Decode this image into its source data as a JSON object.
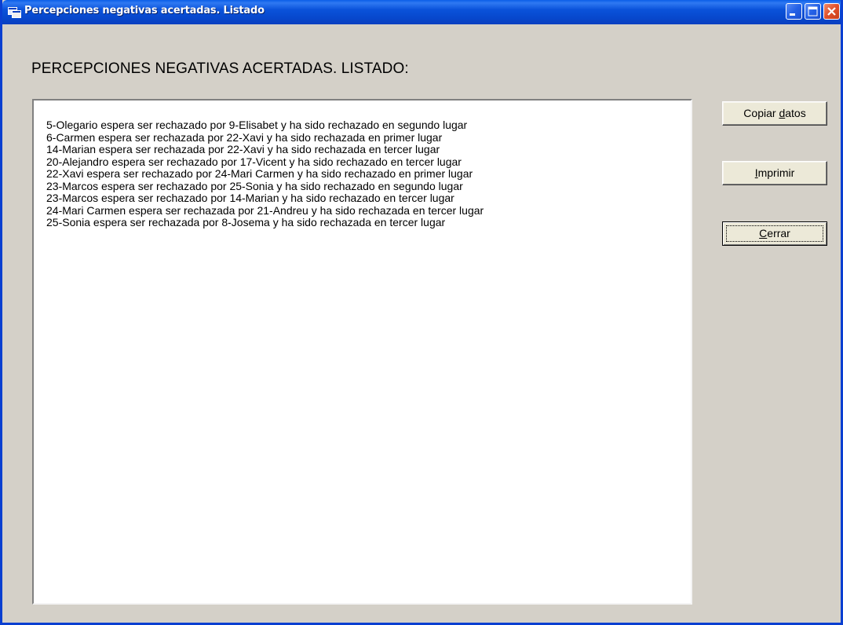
{
  "window": {
    "title": "Percepciones negativas acertadas. Listado",
    "icon": "app-window-icon"
  },
  "heading": "PERCEPCIONES NEGATIVAS ACERTADAS. LISTADO:",
  "list": {
    "items": [
      "5-Olegario espera ser rechazado por 9-Elisabet y ha sido rechazado en segundo lugar",
      "6-Carmen espera ser rechazada por 22-Xavi y ha sido rechazada en primer lugar",
      "14-Marian espera ser rechazada por 22-Xavi y ha sido rechazada en tercer lugar",
      "20-Alejandro espera ser rechazado por 17-Vicent y ha sido rechazado en tercer lugar",
      "22-Xavi espera ser rechazado por 24-Mari Carmen y ha sido rechazado en primer lugar",
      "23-Marcos espera ser rechazado por 25-Sonia y ha sido rechazado en segundo lugar",
      "23-Marcos espera ser rechazado por 14-Marian y ha sido rechazado en tercer lugar",
      "24-Mari Carmen espera ser rechazada por 21-Andreu y ha sido rechazada en tercer lugar",
      "25-Sonia espera ser rechazada por 8-Josema y ha sido rechazada en tercer lugar"
    ]
  },
  "buttons": {
    "copy": {
      "before": "Copiar ",
      "mnemonic": "d",
      "after": "atos"
    },
    "print": {
      "before": "",
      "mnemonic": "I",
      "after": "mprimir"
    },
    "close": {
      "before": "",
      "mnemonic": "C",
      "after": "errar"
    }
  },
  "colors": {
    "titlebar": "#0a52da",
    "face": "#d4d0c8",
    "close_button": "#e0502a"
  }
}
